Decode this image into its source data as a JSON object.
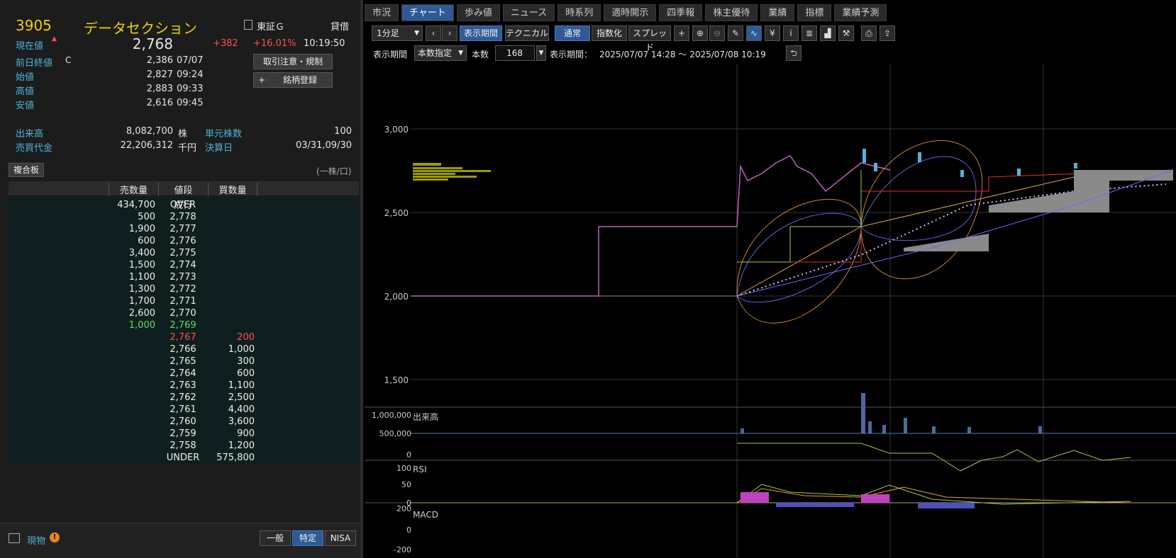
{
  "stock": {
    "code": "3905",
    "name": "データセクション",
    "current_label": "現在値",
    "price": "2,768",
    "change": "+382",
    "change_pct": "+16.01%",
    "time": "10:19:50",
    "market": "東証Ｇ",
    "margin": "貸借"
  },
  "stats": {
    "prev_label": "前日終値",
    "prev_flag": "C",
    "prev": "2,386",
    "prev_date": "07/07",
    "open_label": "始値",
    "open": "2,827",
    "open_time": "09:24",
    "high_label": "高値",
    "high": "2,883",
    "high_time": "09:33",
    "low_label": "安値",
    "low": "2,616",
    "low_time": "09:45"
  },
  "volume": {
    "label": "出来高",
    "value": "8,082,700",
    "unit": "株",
    "unit_label": "単元株数",
    "unit_value": "100",
    "turnover_label": "売買代金",
    "turnover": "22,206,312",
    "turnover_unit": "千円",
    "settle_label": "決算日",
    "settle": "03/31,09/30"
  },
  "buttons": {
    "rules": "取引注意・規制",
    "register": "銘柄登録",
    "register_plus": "+"
  },
  "book": {
    "tab": "複合板",
    "unit": "(一株/口)",
    "col_sell": "売数量",
    "col_price": "値段",
    "col_buy": "買数量",
    "market_order": "成行",
    "sell": [
      [
        "434,700",
        "OVER"
      ],
      [
        "500",
        "2,778"
      ],
      [
        "1,900",
        "2,777"
      ],
      [
        "600",
        "2,776"
      ],
      [
        "3,400",
        "2,775"
      ],
      [
        "1,500",
        "2,774"
      ],
      [
        "1,100",
        "2,773"
      ],
      [
        "1,300",
        "2,772"
      ],
      [
        "1,700",
        "2,771"
      ],
      [
        "2,600",
        "2,770"
      ],
      [
        "1,000",
        "2,769"
      ]
    ],
    "buy": [
      [
        "2,767",
        "200"
      ],
      [
        "2,766",
        "1,000"
      ],
      [
        "2,765",
        "300"
      ],
      [
        "2,764",
        "600"
      ],
      [
        "2,763",
        "1,100"
      ],
      [
        "2,762",
        "2,500"
      ],
      [
        "2,761",
        "4,400"
      ],
      [
        "2,760",
        "3,600"
      ],
      [
        "2,759",
        "900"
      ],
      [
        "2,758",
        "1,200"
      ],
      [
        "UNDER",
        "575,800"
      ]
    ]
  },
  "footer": {
    "mode": "現物",
    "b1": "一般",
    "b2": "特定",
    "b3": "NISA"
  },
  "tabs": [
    "市況",
    "チャート",
    "歩み値",
    "ニュース",
    "時系列",
    "適時開示",
    "四季報",
    "株主優待",
    "業績",
    "指標",
    "業績予測"
  ],
  "toolbar": {
    "interval": "1分足",
    "period_btn": "表示期間",
    "tech": "テクニカル",
    "normal": "通常",
    "index": "指数化",
    "spread": "スプレッド",
    "period_label": "表示期間",
    "period_select": "本数指定",
    "count_label": "本数",
    "count": "168",
    "range_label": "表示期間：",
    "range": "2025/07/07 14:28 〜 2025/07/08 10:19",
    "yen": "¥",
    "info": "i"
  },
  "chart": {
    "y_ticks": [
      "3,000",
      "2,500",
      "2,000",
      "1,500"
    ],
    "vol_label": "出来高",
    "vol_ticks": [
      "1,000,000",
      "500,000",
      "0"
    ],
    "rsi_label": "RSI",
    "rsi_ticks": [
      "100",
      "50",
      "0"
    ],
    "macd_label": "MACD",
    "macd_ticks": [
      "200",
      "0",
      "-200"
    ]
  },
  "colors": {
    "up": "#ff4d4d",
    "accent": "#2f5a95",
    "label": "#4fb3d9",
    "code": "#f0d000"
  }
}
